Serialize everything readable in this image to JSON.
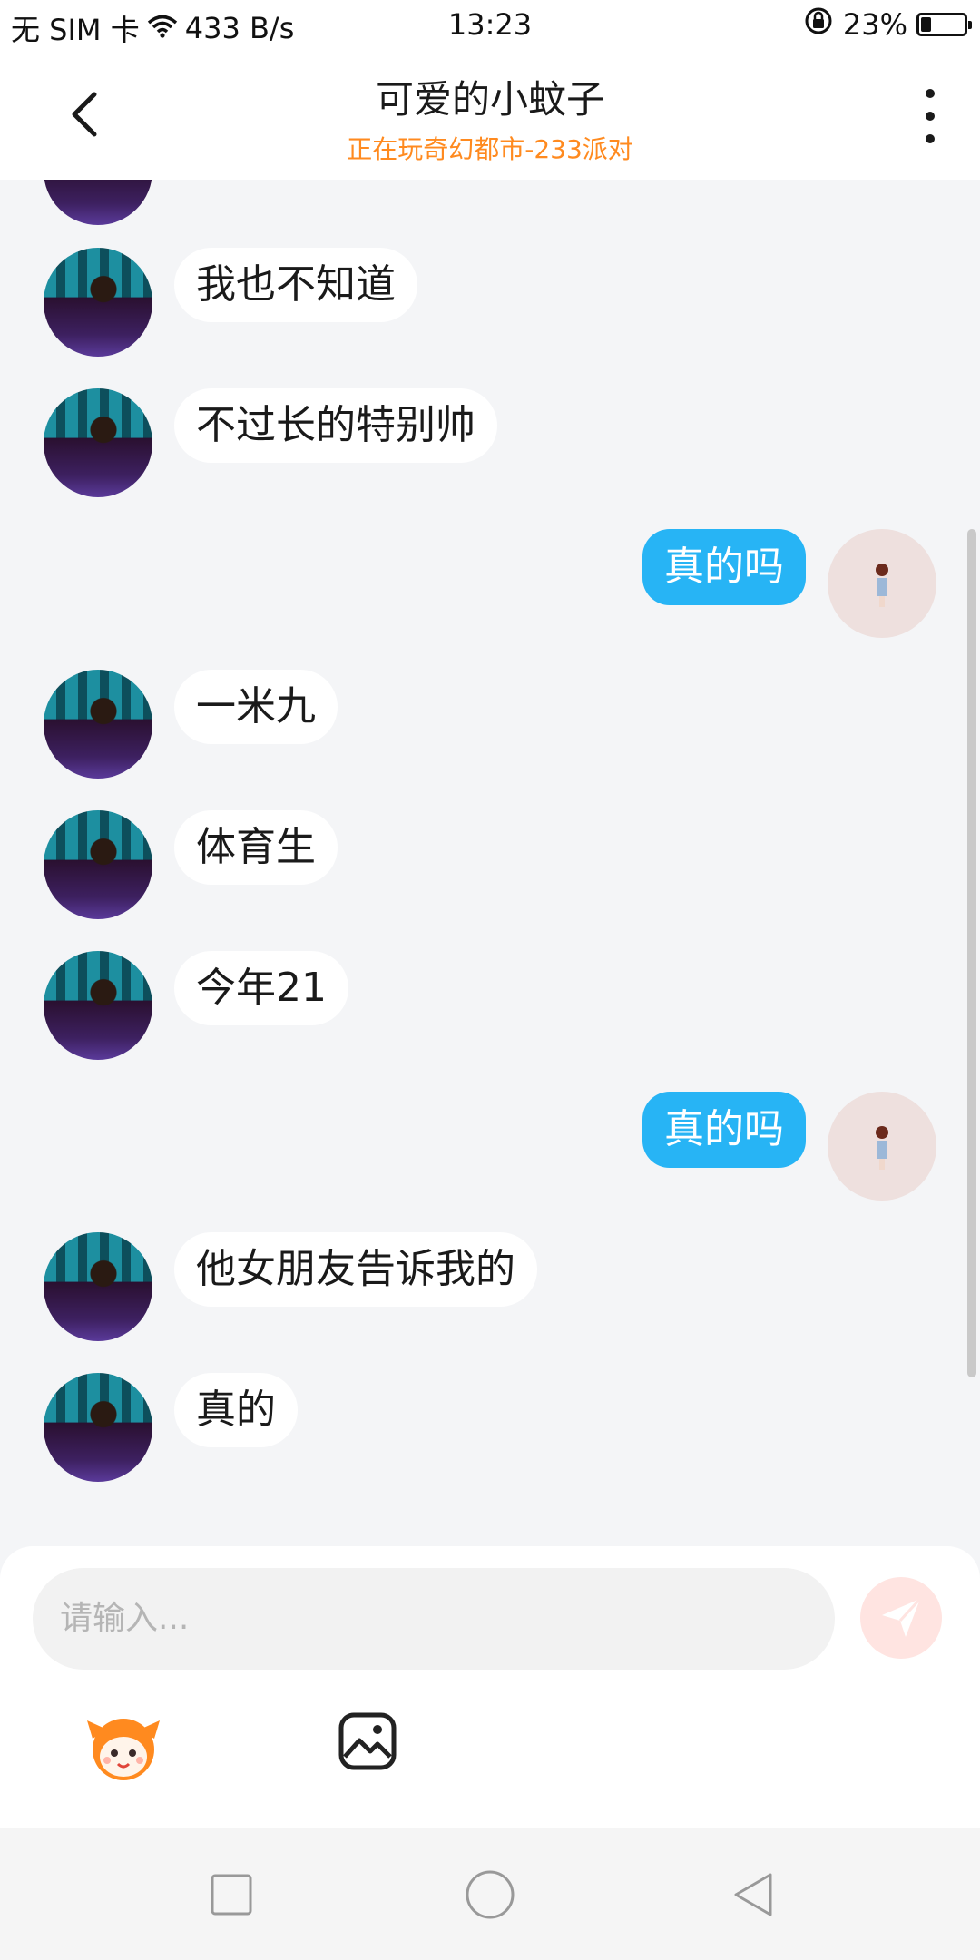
{
  "status_bar": {
    "carrier": "无 SIM 卡",
    "net_speed": "433 B/s",
    "time": "13:23",
    "battery": "23%",
    "battery_level": 0.23
  },
  "header": {
    "title": "可爱的小蚊子",
    "subtitle": "正在玩奇幻都市-233派对"
  },
  "messages": [
    {
      "side": "left",
      "text": "我也不知道"
    },
    {
      "side": "left",
      "text": "不过长的特别帅"
    },
    {
      "side": "right",
      "text": "真的吗"
    },
    {
      "side": "left",
      "text": "一米九"
    },
    {
      "side": "left",
      "text": "体育生"
    },
    {
      "side": "left",
      "text": "今年21"
    },
    {
      "side": "right",
      "text": "真的吗"
    },
    {
      "side": "left",
      "text": "他女朋友告诉我的"
    },
    {
      "side": "left",
      "text": "真的"
    }
  ],
  "input": {
    "placeholder": "请输入..."
  },
  "icons": {
    "back": "back-arrow-icon",
    "more": "more-vertical-icon",
    "send": "send-icon",
    "emoji": "emoji-mascot-icon",
    "image": "image-icon"
  },
  "colors": {
    "accent_orange": "#ff8a1f",
    "bubble_blue": "#27b4f5",
    "send_disabled": "#ffe4e1"
  }
}
